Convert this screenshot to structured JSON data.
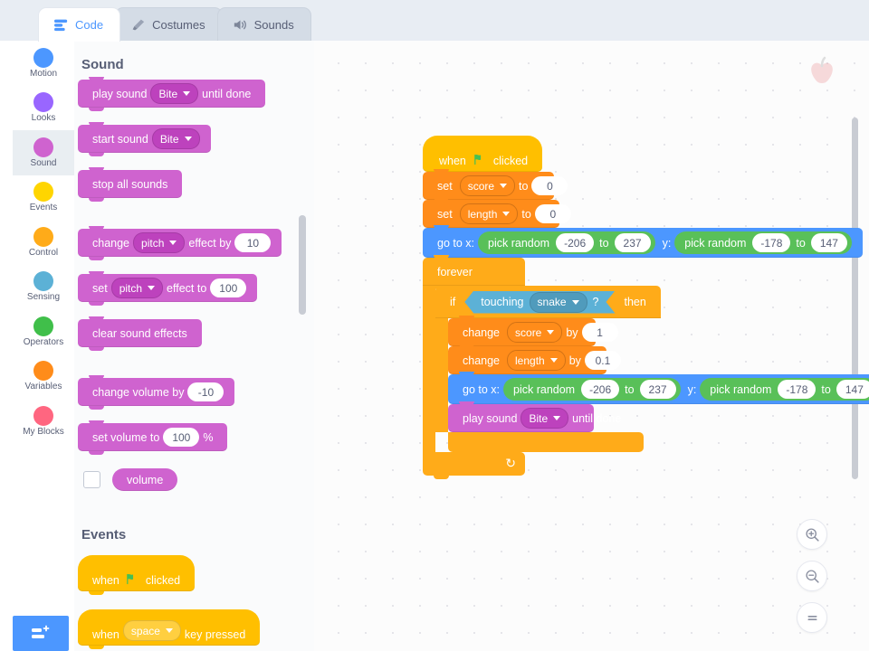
{
  "tabs": [
    {
      "label": "Code",
      "icon": "code-icon",
      "active": true
    },
    {
      "label": "Costumes",
      "icon": "brush-icon",
      "active": false
    },
    {
      "label": "Sounds",
      "icon": "speaker-icon",
      "active": false
    }
  ],
  "categories": [
    {
      "label": "Motion",
      "color": "#4C97FF",
      "selected": false
    },
    {
      "label": "Looks",
      "color": "#9966FF",
      "selected": false
    },
    {
      "label": "Sound",
      "color": "#CF63CF",
      "selected": true
    },
    {
      "label": "Events",
      "color": "#FFD500",
      "selected": false
    },
    {
      "label": "Control",
      "color": "#FFAB19",
      "selected": false
    },
    {
      "label": "Sensing",
      "color": "#5CB1D6",
      "selected": false
    },
    {
      "label": "Operators",
      "color": "#40BF4A",
      "selected": false
    },
    {
      "label": "Variables",
      "color": "#FF8C1A",
      "selected": false
    },
    {
      "label": "My Blocks",
      "color": "#FF6680",
      "selected": false
    }
  ],
  "palette": {
    "sections": [
      {
        "heading": "Sound"
      },
      {
        "heading": "Events"
      }
    ],
    "sound_blocks": {
      "play_sound_pre": "play sound",
      "play_sound_menu": "Bite",
      "play_sound_post": "until done",
      "start_sound_pre": "start sound",
      "start_sound_menu": "Bite",
      "stop_all_sounds": "stop all sounds",
      "change_effect_pre": "change",
      "change_effect_menu": "pitch",
      "change_effect_mid": "effect by",
      "change_effect_val": "10",
      "set_effect_pre": "set",
      "set_effect_menu": "pitch",
      "set_effect_mid": "effect to",
      "set_effect_val": "100",
      "clear_sound_effects": "clear sound effects",
      "change_volume_pre": "change volume by",
      "change_volume_val": "-10",
      "set_volume_pre": "set volume to",
      "set_volume_val": "100",
      "set_volume_post": "%",
      "volume_reporter": "volume",
      "volume_checkbox_checked": false
    },
    "events_blocks": {
      "when_flag_pre": "when",
      "when_flag_post": "clicked",
      "when_key_pre": "when",
      "when_key_menu": "space",
      "when_key_post": "key pressed"
    }
  },
  "script": {
    "when_flag_pre": "when",
    "when_flag_post": "clicked",
    "set_score": {
      "pre": "set",
      "menu": "score",
      "mid": "to",
      "val": "0"
    },
    "set_length": {
      "pre": "set",
      "menu": "length",
      "mid": "to",
      "val": "0"
    },
    "goto_top": {
      "pre": "go to x:",
      "x_pre": "pick random",
      "x_from": "-206",
      "x_to_lbl": "to",
      "x_to": "237",
      "y_lbl": "y:",
      "y_pre": "pick random",
      "y_from": "-178",
      "y_to_lbl": "to",
      "y_to": "147"
    },
    "forever": "forever",
    "if_pre": "if",
    "if_cond_pre": "touching",
    "if_cond_menu": "snake",
    "if_cond_q": "?",
    "if_post": "then",
    "change_score": {
      "pre": "change",
      "menu": "score",
      "mid": "by",
      "val": "1"
    },
    "change_length": {
      "pre": "change",
      "menu": "length",
      "mid": "by",
      "val": "0.1"
    },
    "goto_inner": {
      "pre": "go to x:",
      "x_pre": "pick random",
      "x_from": "-206",
      "x_to_lbl": "to",
      "x_to": "237",
      "y_lbl": "y:",
      "y_pre": "pick random",
      "y_from": "-178",
      "y_to_lbl": "to",
      "y_to": "147"
    },
    "play_sound": {
      "pre": "play sound",
      "menu": "Bite",
      "post": "until done"
    },
    "loop_arrow": "↻"
  },
  "canvas_controls": {
    "zoom_in": "zoom-in-icon",
    "zoom_out": "zoom-out-icon",
    "zoom_reset": "zoom-reset-icon"
  },
  "sprite_watermark": "apple-sprite-watermark",
  "add_extension_button": "add-extension-button",
  "colors": {
    "sound": "#CF63CF",
    "events": "#FFBF00",
    "control": "#FFAB19",
    "motion": "#4C97FF",
    "sensing": "#5CB1D6",
    "operators": "#59C059",
    "variables": "#FF8C1A",
    "accent": "#4C97FF",
    "text": "#575E75"
  }
}
